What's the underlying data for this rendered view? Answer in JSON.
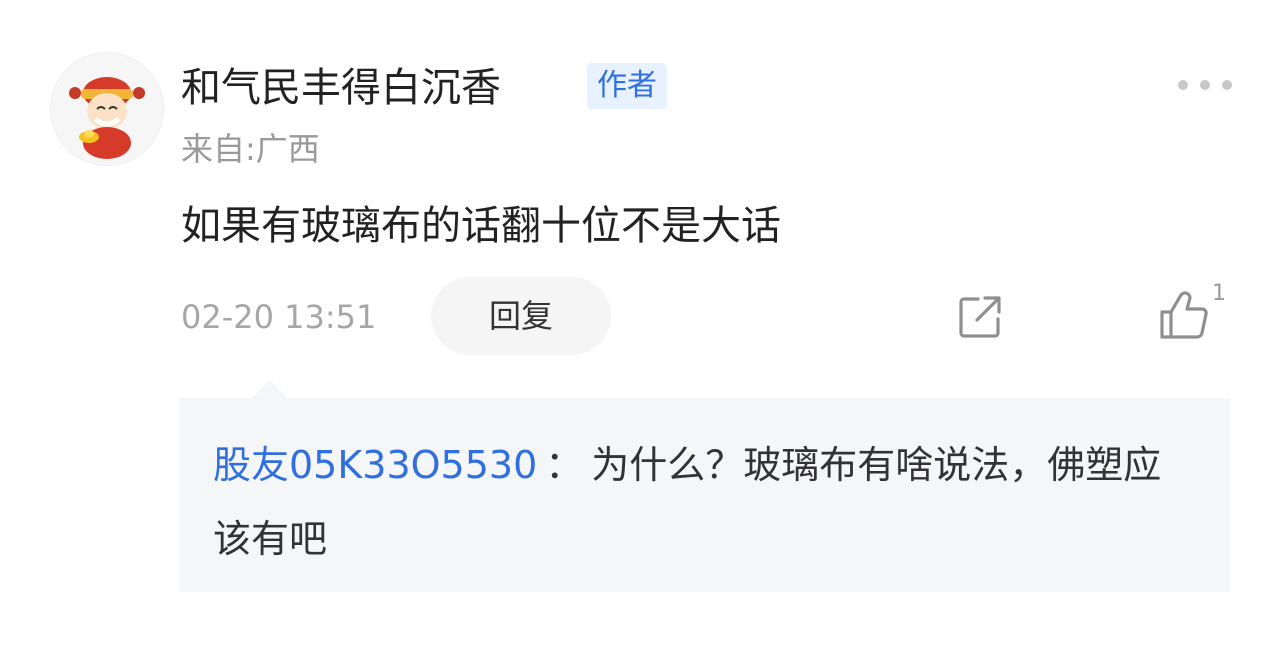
{
  "comment": {
    "username": "和气民丰得白沉香",
    "author_badge": "作者",
    "location": "来自:广西",
    "content": "如果有玻璃布的话翻十位不是大话",
    "timestamp": "02-20 13:51",
    "reply_label": "回复",
    "like_count": "1",
    "icons": {
      "avatar": "avatar-cartoon-god-of-wealth",
      "more": "more-horizontal-icon",
      "share": "share-icon",
      "like": "thumbs-up-icon"
    },
    "colors": {
      "accent": "#2f6fe0",
      "badge_bg": "#e8f1fe",
      "reply_bg": "#f5f6f8"
    }
  },
  "reply": {
    "user": "股友05K33O5530",
    "separator": "：",
    "text": "为什么？玻璃布有啥说法，佛塑应该有吧"
  }
}
